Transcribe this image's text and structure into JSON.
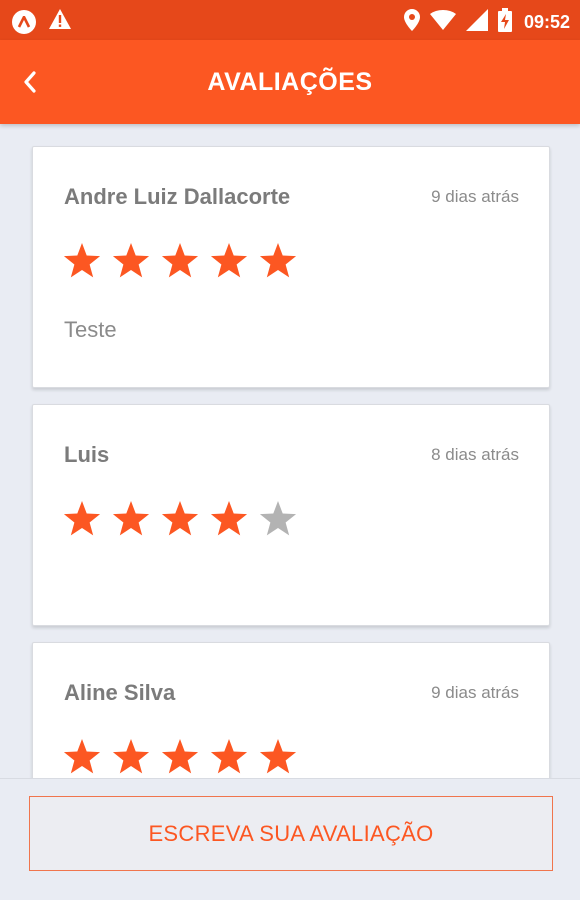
{
  "status_bar": {
    "time": "09:52",
    "left_icons": [
      "app-notification-icon",
      "warning-icon"
    ],
    "right_icons": [
      "location-icon",
      "wifi-icon",
      "signal-icon",
      "battery-charging-icon"
    ]
  },
  "app_bar": {
    "title": "AVALIAÇÕES",
    "back_icon": "chevron-left-icon"
  },
  "colors": {
    "accent": "#fc5722",
    "status_bar": "#e6481a",
    "star_filled": "#fc5722",
    "star_empty": "#b3b3b3",
    "background": "#e9ecf3"
  },
  "reviews": [
    {
      "name": "Andre Luiz Dallacorte",
      "time": "9 dias atrás",
      "rating": 5,
      "max_rating": 5,
      "comment": "Teste"
    },
    {
      "name": "Luis",
      "time": "8 dias atrás",
      "rating": 4,
      "max_rating": 5,
      "comment": ""
    },
    {
      "name": "Aline Silva",
      "time": "9 dias atrás",
      "rating": 5,
      "max_rating": 5,
      "comment": ""
    }
  ],
  "footer": {
    "write_review_label": "ESCREVA SUA AVALIAÇÃO"
  }
}
